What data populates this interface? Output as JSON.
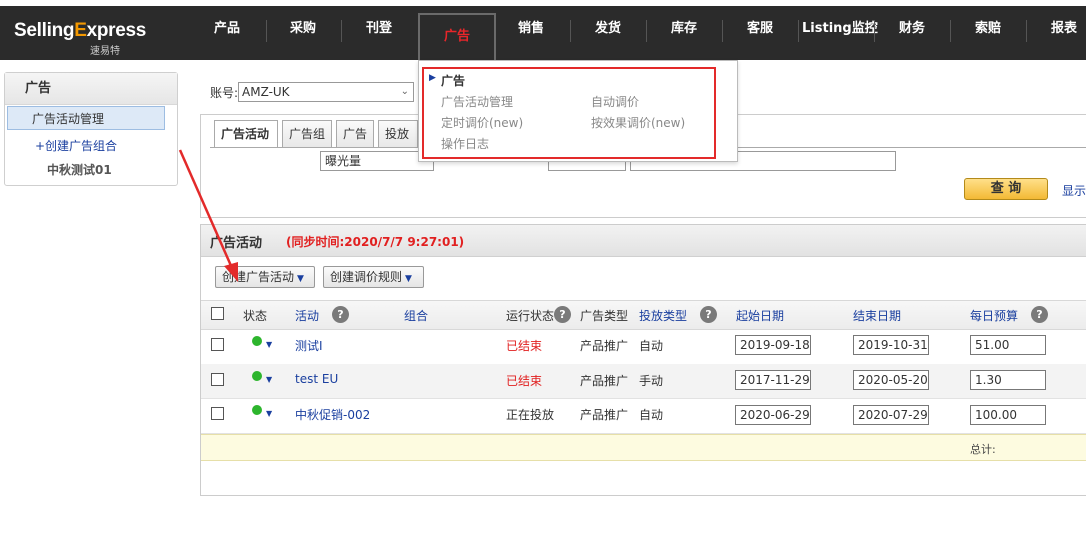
{
  "logo": {
    "brand_main": "Selling",
    "brand_ex": "E",
    "brand_tail": "xpress",
    "brand_cn": "速易特"
  },
  "nav": [
    "产品",
    "采购",
    "刊登",
    "广告",
    "销售",
    "发货",
    "库存",
    "客服",
    "Listing监控",
    "财务",
    "索赔",
    "报表"
  ],
  "nav_active": "广告",
  "sidebar": {
    "title": "广告",
    "active_item": "广告活动管理",
    "sub_create": "+创建广告组合",
    "sub_group": "中秋测试01"
  },
  "account": {
    "label": "账号:",
    "value": "AMZ-UK"
  },
  "tabs": [
    "广告活动",
    "广告组",
    "广告",
    "投放"
  ],
  "filter": {
    "metric": "曝光量"
  },
  "query_button": "查 询",
  "show_link": "显示",
  "dropdown": {
    "head": "广告",
    "items": [
      "广告活动管理",
      "自动调价",
      "定时调价(new)",
      "按效果调价(new)",
      "操作日志"
    ]
  },
  "section": {
    "title": "广告活动",
    "sync": "(同步时间:2020/7/7 9:27:01)",
    "create_campaign": "创建广告活动",
    "create_rule": "创建调价规则"
  },
  "table": {
    "headers": {
      "status": "状态",
      "campaign": "活动",
      "group": "组合",
      "run_status": "运行状态",
      "ad_type": "广告类型",
      "target_type": "投放类型",
      "start": "起始日期",
      "end": "结束日期",
      "budget": "每日预算"
    },
    "rows": [
      {
        "name": "测试I",
        "run_status": "已结束",
        "ad_type": "产品推广",
        "target_type": "自动",
        "start": "2019-09-18",
        "end": "2019-10-31",
        "budget": "51.00"
      },
      {
        "name": "test EU",
        "run_status": "已结束",
        "ad_type": "产品推广",
        "target_type": "手动",
        "start": "2017-11-29",
        "end": "2020-05-20",
        "budget": "1.30"
      },
      {
        "name": "中秋促销-002",
        "run_status": "正在投放",
        "ad_type": "产品推广",
        "target_type": "自动",
        "start": "2020-06-29",
        "end": "2020-07-29",
        "budget": "100.00"
      }
    ],
    "total_label": "总计:"
  },
  "colors": {
    "nav_bg": "#2b2b2b",
    "accent_red": "#e12020",
    "link_blue": "#1a3f9f",
    "status_green": "#2db52d",
    "query_gold": "#f3b935"
  }
}
